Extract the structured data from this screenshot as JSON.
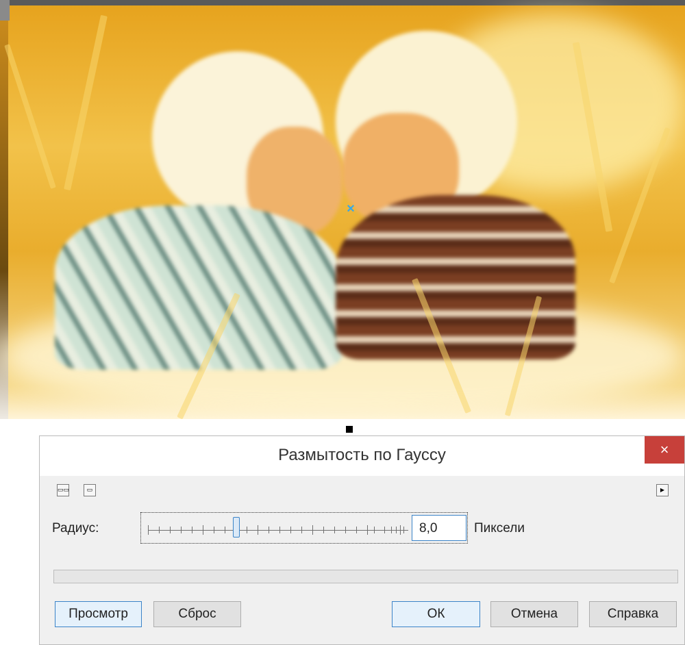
{
  "dialog": {
    "title": "Размытость по Гауссу",
    "close_symbol": "×",
    "radius_label": "Радиус:",
    "radius_value": "8,0",
    "units_label": "Пиксели",
    "slider_level_fraction": 0.34,
    "progress_fraction": 0,
    "toolbar_icons": [
      "split-view-icon",
      "single-view-icon",
      "expand-arrow-icon"
    ],
    "buttons": {
      "preview": "Просмотр",
      "reset": "Сброс",
      "ok": "ОК",
      "cancel": "Отмена",
      "help": "Справка"
    }
  },
  "colors": {
    "close_button": "#c7403a",
    "focus_border": "#3a83c8",
    "dialog_background": "#f0f0f0"
  }
}
